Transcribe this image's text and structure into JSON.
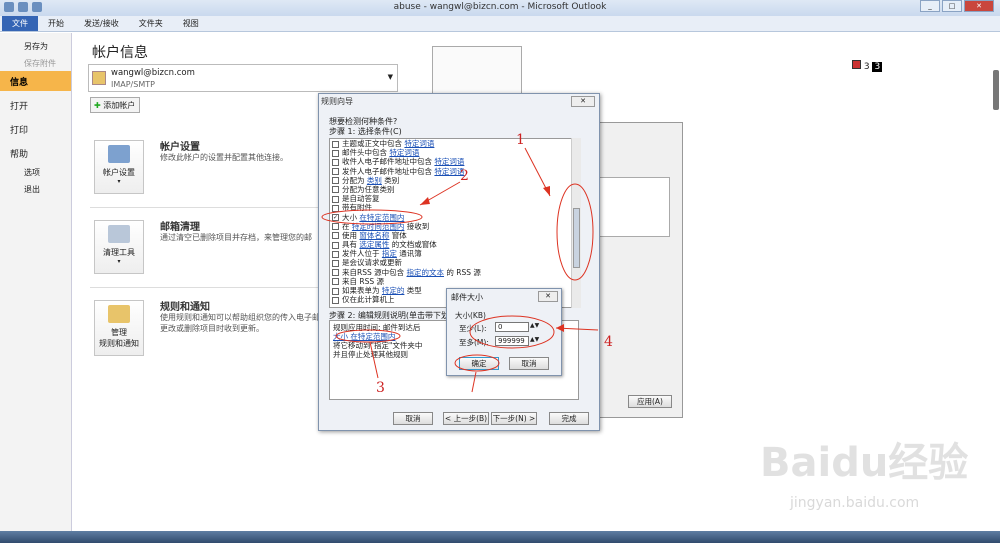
{
  "window": {
    "title": "abuse - wangwl@bizcn.com - Microsoft Outlook"
  },
  "ribbon": {
    "tabs": [
      "文件",
      "开始",
      "发送/接收",
      "文件夹",
      "视图"
    ]
  },
  "sidebar": {
    "items": [
      "另存为",
      "保存附件",
      "信息",
      "打开",
      "打印",
      "帮助",
      "选项",
      "退出"
    ]
  },
  "main": {
    "title": "帐户信息",
    "account_email": "wangwl@bizcn.com",
    "account_type": "IMAP/SMTP",
    "add_account": "添加帐户",
    "sections": [
      {
        "tile": "帐户设置",
        "head": "帐户设置",
        "desc": "修改此帐户的设置并配置其他连接。"
      },
      {
        "tile": "清理工具",
        "head": "邮箱清理",
        "desc": "通过清空已删除项目并存档，来管理您的邮"
      },
      {
        "tile1": "管理",
        "tile2": "规则和通知",
        "head": "规则和通知",
        "desc": [
          "使用规则和通知可以帮助组织您的传入电子邮",
          "更改或删除项目时收到更新。"
        ]
      }
    ]
  },
  "badge": {
    "text": "3"
  },
  "dialog": {
    "title": "规则向导",
    "question": "想要检测何种条件?",
    "step1": "步骤 1: 选择条件(C)",
    "conditions": [
      [
        "主题或正文中包含",
        "特定词语",
        ""
      ],
      [
        "邮件头中包含",
        "特定词语",
        ""
      ],
      [
        "收件人电子邮件地址中包含",
        "特定词语",
        ""
      ],
      [
        "发件人电子邮件地址中包含",
        "特定词语",
        ""
      ],
      [
        "分配为",
        "类别",
        "类别"
      ],
      [
        "分配为任意类别",
        "",
        ""
      ],
      [
        "是自动答复",
        "",
        ""
      ],
      [
        "带有附件",
        "",
        ""
      ],
      [
        "大小",
        "在特定范围内",
        ""
      ],
      [
        "在",
        "特定时间范围内",
        "接收到"
      ],
      [
        "使用",
        "窗体名称",
        "窗体"
      ],
      [
        "具有",
        "选定属性",
        "的文档或窗体"
      ],
      [
        "发件人位于",
        "指定",
        "通讯簿"
      ],
      [
        "是会议请求或更新",
        "",
        ""
      ],
      [
        "来自RSS 源中包含",
        "指定的文本",
        "的 RSS 源"
      ],
      [
        "来自 RSS 源",
        "",
        ""
      ],
      [
        "如果表单为",
        "特定的",
        "类型"
      ],
      [
        "仅在此计算机上",
        "",
        ""
      ]
    ],
    "checked_index": 8,
    "step2": "步骤 2: 编辑规则说明(单击带下划",
    "desc_lines": [
      "规则应用时间: 邮件到达后",
      "大小 在特定范围内",
      "将它移动到\"指定\"文件夹中",
      "并且停止处理其他规则"
    ],
    "buttons": {
      "cancel": "取消",
      "back": "< 上一步(B)",
      "next": "下一步(N) >",
      "finish": "完成"
    }
  },
  "back_dialog": {
    "apply": "应用(A)"
  },
  "popup": {
    "title": "邮件大小",
    "group": "大小(KB)",
    "min_label": "至少(L):",
    "min_value": "0",
    "max_label": "至多(M):",
    "max_value": "999999",
    "ok": "确定",
    "cancel": "取消"
  },
  "annotations": [
    "1",
    "2",
    "3",
    "4"
  ],
  "watermark": {
    "main": "Baidu经验",
    "sub": "jingyan.baidu.com"
  }
}
